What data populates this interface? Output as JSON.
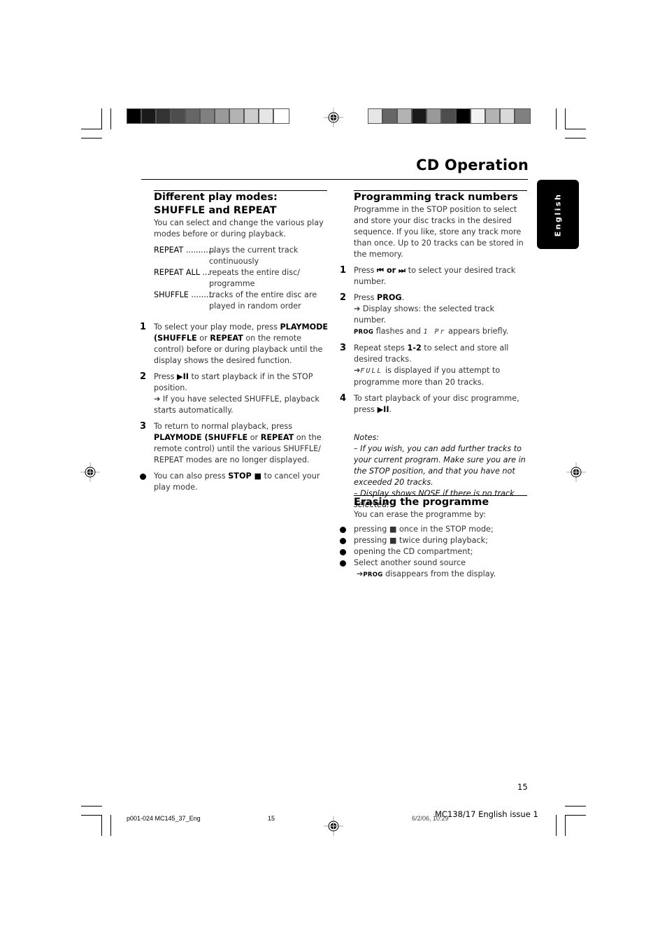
{
  "header": {
    "title": "CD Operation",
    "language_tab": "English",
    "swatches_left": [
      "#000000",
      "#1a1a1a",
      "#333333",
      "#4d4d4d",
      "#666666",
      "#808080",
      "#999999",
      "#b3b3b3",
      "#cccccc",
      "#e6e6e6",
      "#ffffff"
    ],
    "swatches_right": [
      "#e6e6e6",
      "#666666",
      "#b3b3b3",
      "#1a1a1a",
      "#999999",
      "#4d4d4d",
      "#000000",
      "#f2f2f2",
      "#b3b3b3",
      "#d9d9d9",
      "#808080"
    ]
  },
  "left_column": {
    "heading": "Different play modes: SHUFFLE and REPEAT",
    "intro": "You can select and change the various play modes before or during playback.",
    "definitions": [
      {
        "term": "REPEAT ............",
        "desc": "plays the current track continuously"
      },
      {
        "term": "REPEAT ALL ...",
        "desc": "repeats the entire disc/ programme"
      },
      {
        "term": "SHUFFLE .........",
        "desc": "tracks of the entire disc are played in random order"
      }
    ],
    "steps": [
      {
        "num": "1",
        "t1": "To select your play mode, press ",
        "b1": "PLAYMODE (SHUFFLE",
        "t2": " or ",
        "b2": "REPEAT",
        "t3": " on the remote control) before or during playback until the display shows the desired function."
      },
      {
        "num": "2",
        "t1": "Press ",
        "b1": "▶II",
        "t2": " to start playback if in the STOP position.",
        "result": "➔ If you have selected SHUFFLE, playback starts automatically."
      },
      {
        "num": "3",
        "t1": "To return to normal playback, press ",
        "b1": "PLAYMODE (SHUFFLE",
        "t2": " or ",
        "b2": "REPEAT",
        "t3": " on the remote control) until the various SHUFFLE/ REPEAT modes are no longer displayed."
      }
    ],
    "bullet": {
      "t1": "You can also press ",
      "b1": "STOP ■",
      "t2": " to cancel your play mode."
    }
  },
  "right_column": {
    "heading": "Programming track numbers",
    "intro": "Programme in the STOP position to select and store your disc tracks in the desired sequence. If you like, store any track more than once. Up to 20 tracks can be stored in the memory.",
    "steps": [
      {
        "num": "1",
        "t1": "Press ",
        "b1": "⏮ or ⏭",
        "t2": "  to select your desired track number."
      },
      {
        "num": "2",
        "t1": "Press ",
        "b1": "PROG",
        "t2": ".",
        "result": "➔ Display shows: the selected track number.",
        "prog": "PROG",
        "t3": " flashes and ",
        "seg": "1 Pr",
        "t4": "  appears briefly."
      },
      {
        "num": "3",
        "t1": "Repeat steps ",
        "b1": "1-2",
        "t2": " to select and store all desired tracks.",
        "arrow": "➔",
        "seg": "FULL",
        "t3": " is displayed if you attempt to programme more than 20 tracks."
      },
      {
        "num": "4",
        "t1": "To start playback of your disc programme, press ",
        "b1": "▶II",
        "t2": "."
      }
    ],
    "notes_label": "Notes:",
    "notes": [
      "–  If you wish, you can add further tracks to your current program. Make sure you are in the STOP position, and that you have not exceeded 20 tracks.",
      "–  Display shows NOSE if there is no track selected."
    ],
    "erase_heading": "Erasing the programme",
    "erase_intro": "You can erase the programme by:",
    "erase_bullets": [
      "pressing ■ once in the STOP mode;",
      "pressing ■ twice during playback;",
      "opening the CD compartment;",
      "Select another sound source"
    ],
    "erase_result_arrow": "➔",
    "erase_result_prog": "PROG",
    "erase_result_text": " disappears from the display."
  },
  "footer": {
    "page_number": "15",
    "issue": "MC138/17 English issue 1",
    "file_name": "p001-024 MC145_37_Eng",
    "file_page": "15",
    "timestamp": "6/2/06, 10:29"
  }
}
